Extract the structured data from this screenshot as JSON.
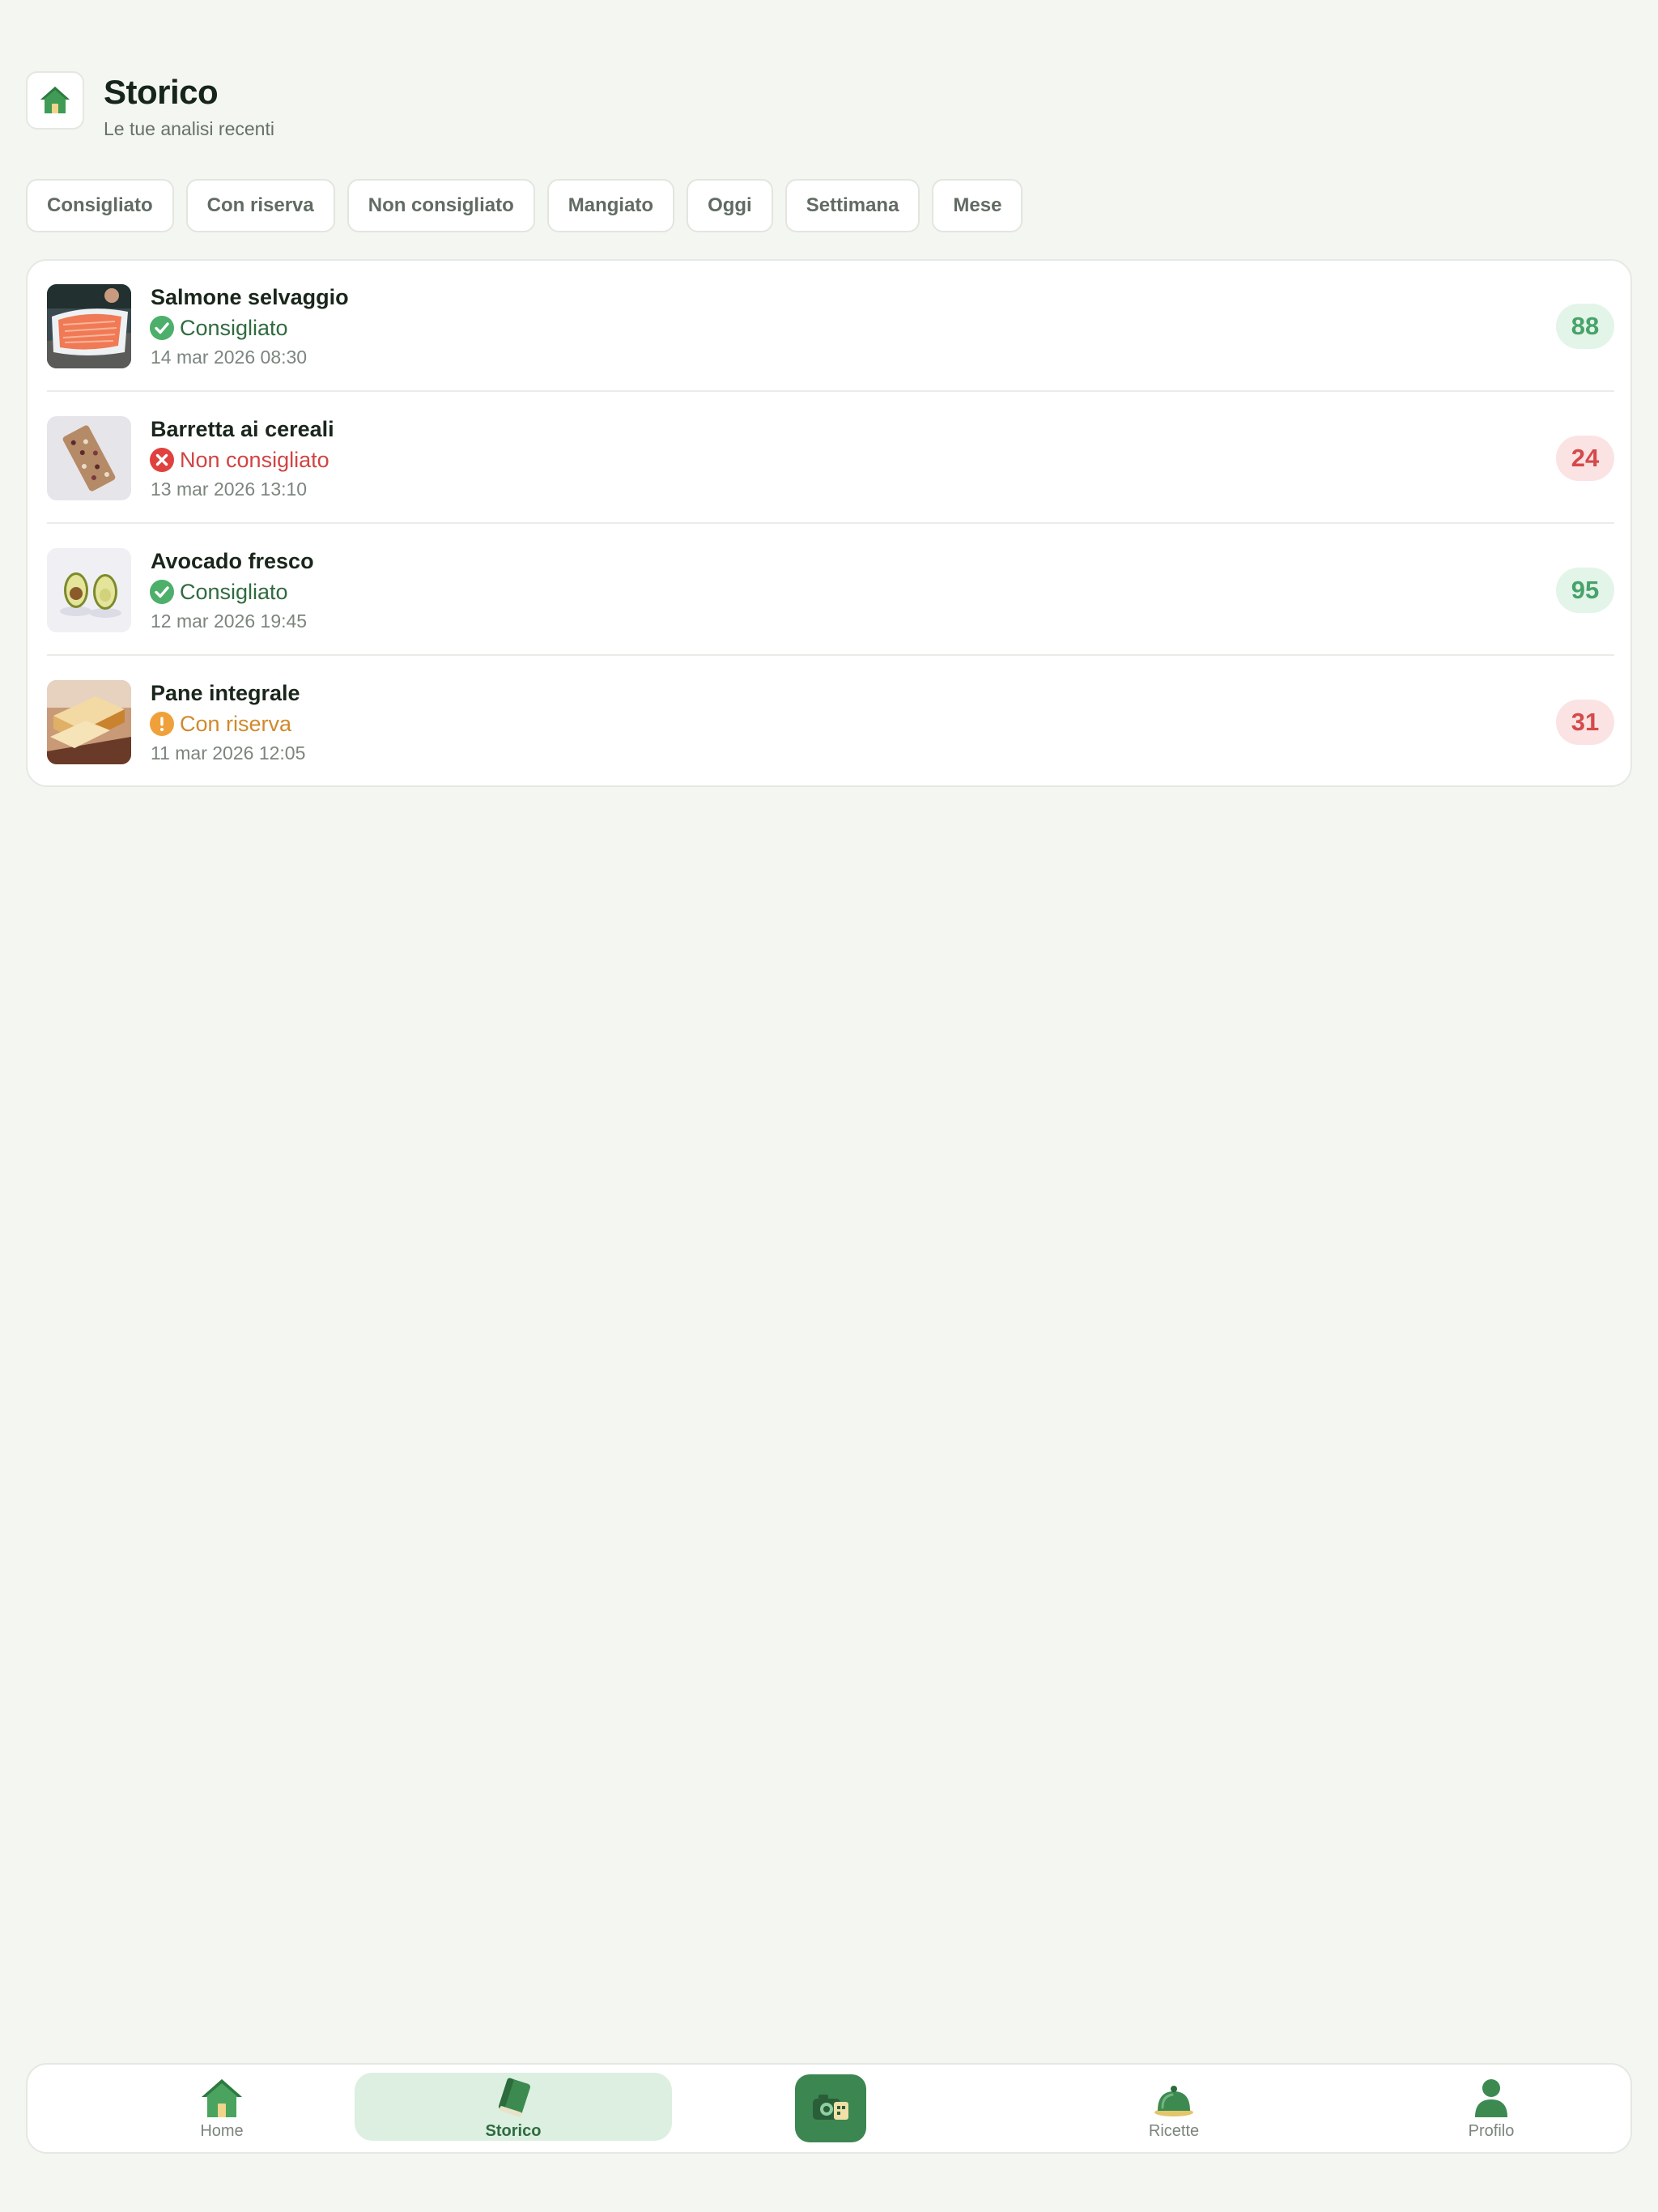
{
  "header": {
    "title": "Storico",
    "subtitle": "Le tue analisi recenti",
    "home_icon": "house-icon"
  },
  "filters": [
    {
      "label": "Consigliato"
    },
    {
      "label": "Con riserva"
    },
    {
      "label": "Non consigliato"
    },
    {
      "label": "Mangiato"
    },
    {
      "label": "Oggi"
    },
    {
      "label": "Settimana"
    },
    {
      "label": "Mese"
    }
  ],
  "items": [
    {
      "name": "Salmone selvaggio",
      "verdict": "Consigliato",
      "verdict_type": "good",
      "date": "14 mar 2026 08:30",
      "score": "88",
      "thumb": "salmon-photo"
    },
    {
      "name": "Barretta ai cereali",
      "verdict": "Non consigliato",
      "verdict_type": "bad",
      "date": "13 mar 2026 13:10",
      "score": "24",
      "thumb": "cereal-bar-photo"
    },
    {
      "name": "Avocado fresco",
      "verdict": "Consigliato",
      "verdict_type": "good",
      "date": "12 mar 2026 19:45",
      "score": "95",
      "thumb": "avocado-photo"
    },
    {
      "name": "Pane integrale",
      "verdict": "Con riserva",
      "verdict_type": "warn",
      "date": "11 mar 2026 12:05",
      "score": "31",
      "thumb": "bread-photo"
    }
  ],
  "colors": {
    "good": "#2f6b3f",
    "good_icon": "#4caf6a",
    "good_score_bg": "#e3f4e8",
    "good_score": "#47a36a",
    "bad": "#d14343",
    "bad_icon": "#e0413f",
    "bad_score_bg": "#fbe3e3",
    "bad_score": "#d44a4a",
    "warn": "#d08a2c",
    "warn_icon": "#f0a03a"
  },
  "tabbar": {
    "tabs": [
      {
        "label": "Home",
        "icon": "house-icon"
      },
      {
        "label": "Storico",
        "icon": "book-icon",
        "active": true
      },
      {
        "label": "",
        "icon": "camera-icon"
      },
      {
        "label": "Ricette",
        "icon": "cloche-icon"
      },
      {
        "label": "Profilo",
        "icon": "person-icon"
      }
    ]
  }
}
